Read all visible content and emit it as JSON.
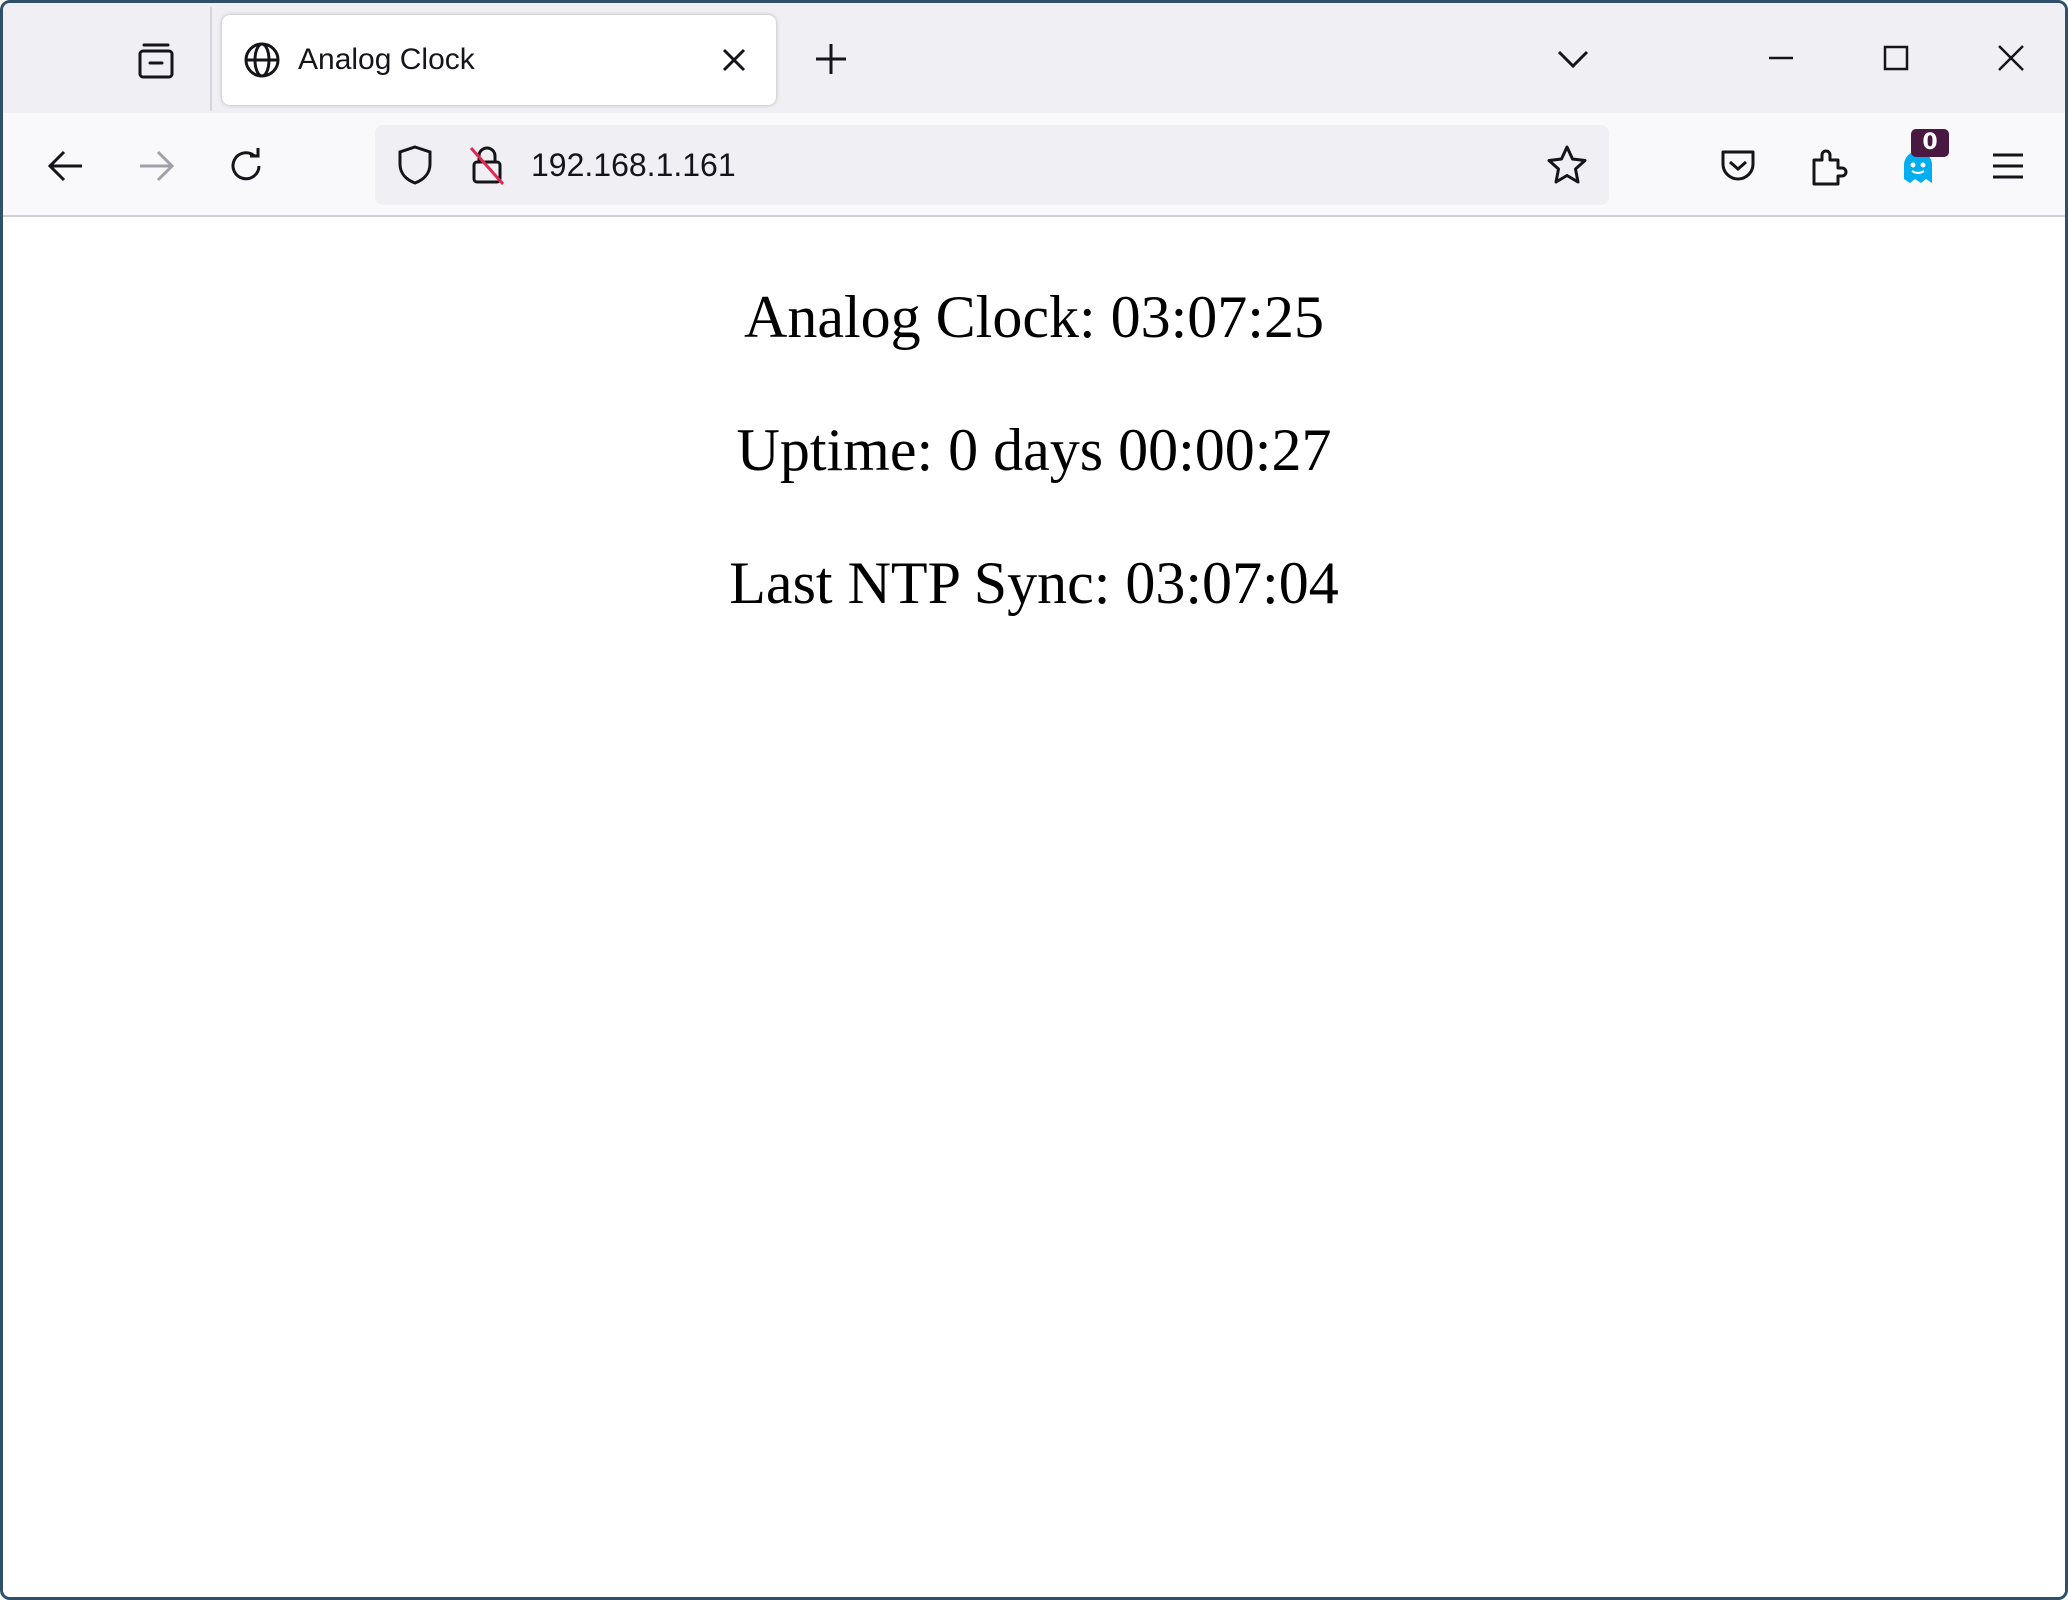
{
  "browser": {
    "tab": {
      "title": "Analog Clock",
      "icon": "globe-icon"
    },
    "window_controls": [
      "minimize-icon",
      "maximize-icon",
      "close-icon"
    ],
    "url": "192.168.1.161",
    "extension_badge": "0",
    "colors": {
      "tab_strip": "#f0f0f4",
      "toolbar": "#f9f9fb",
      "badge": "#4a1942",
      "ghost_extension": "#00aeef",
      "insecure_lock_strike": "#e22850"
    }
  },
  "page": {
    "analog_clock": "Analog Clock: 03:07:25",
    "uptime": "Uptime: 0 days 00:00:27",
    "last_ntp_sync": "Last NTP Sync: 03:07:04"
  }
}
